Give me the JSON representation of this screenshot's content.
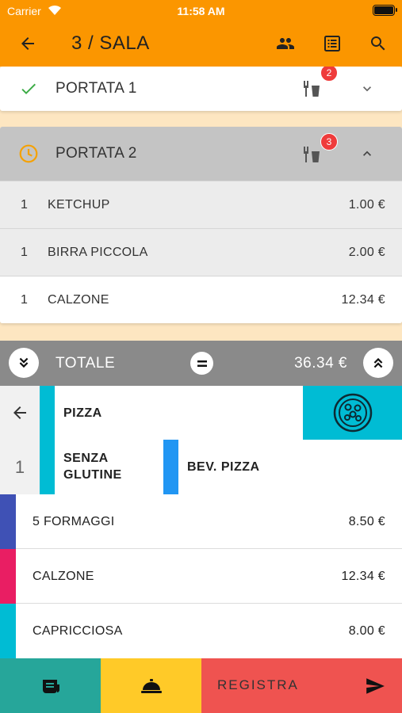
{
  "status_bar": {
    "carrier": "Carrier",
    "time": "11:58 AM"
  },
  "header": {
    "title": "3 / SALA",
    "icons": [
      "arrow-back-icon",
      "people-icon",
      "receipt-list-icon",
      "search-icon"
    ]
  },
  "colors": {
    "header": "#fb9600",
    "courses_bg": "#fde6c1",
    "course_expanded": "#c4c4c4",
    "total_bar": "#8a8a8a",
    "badge": "#ef3b3b",
    "check": "#3bab45",
    "clock": "#f5a100",
    "action_print": "#26a69a",
    "action_bell": "#ffca28",
    "action_registra": "#ef5350"
  },
  "courses": [
    {
      "name": "PORTATA 1",
      "status": "done",
      "badge": "2",
      "expanded": false,
      "items": []
    },
    {
      "name": "PORTATA 2",
      "status": "pending",
      "badge": "3",
      "expanded": true,
      "items": [
        {
          "qty": "1",
          "name": "KETCHUP",
          "price": "1.00 €"
        },
        {
          "qty": "1",
          "name": "BIRRA PICCOLA",
          "price": "2.00 €"
        },
        {
          "qty": "1",
          "name": "CALZONE",
          "price": "12.34 €"
        }
      ]
    }
  ],
  "total": {
    "label": "TOTALE",
    "value": "36.34 €"
  },
  "categories": {
    "quantity": "1",
    "current": {
      "label": "PIZZA",
      "color": "#00bcd4"
    },
    "subcategories": [
      {
        "label": "SENZA GLUTINE",
        "color": "#00bcd4"
      },
      {
        "label": "BEV. PIZZA",
        "color": "#2196f3"
      }
    ]
  },
  "products": [
    {
      "name": "5 FORMAGGI",
      "price": "8.50 €",
      "color": "#3f51b5"
    },
    {
      "name": "CALZONE",
      "price": "12.34 €",
      "color": "#e91e63"
    },
    {
      "name": "CAPRICCIOSA",
      "price": "8.00 €",
      "color": "#00bcd4"
    }
  ],
  "actions": {
    "registra_label": "REGISTRA"
  }
}
